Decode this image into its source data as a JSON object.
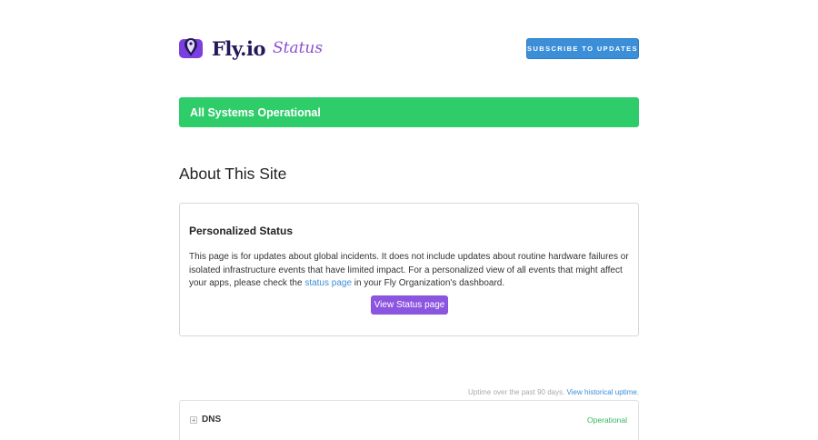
{
  "header": {
    "brand_name": "Fly.io",
    "brand_subtitle": "Status",
    "subscribe_label": "SUBSCRIBE TO UPDATES",
    "logo_icon": "fly-balloon-logo-icon"
  },
  "status_banner": {
    "text": "All Systems Operational",
    "color": "#2fcc6a"
  },
  "about": {
    "title": "About This Site",
    "card_title": "Personalized Status",
    "body_part1": "This page is for updates about global incidents. It does not include updates about routine hardware failures or isolated infrastructure events that have limited impact. For a personalized view of all events that might affect your apps, please check the ",
    "body_link": "status page",
    "body_part2": " in your Fly Organization's dashboard.",
    "button_label": "View Status page"
  },
  "uptime": {
    "note": "Uptime over the past 90 days.",
    "link": "View historical uptime."
  },
  "components": [
    {
      "name": "DNS",
      "status": "Operational",
      "icon": "expand-plus-icon"
    }
  ],
  "colors": {
    "accent_blue": "#3b8ed8",
    "accent_purple": "#8b55e0",
    "operational_green": "#2fb863",
    "brand_navy": "#24185b"
  }
}
